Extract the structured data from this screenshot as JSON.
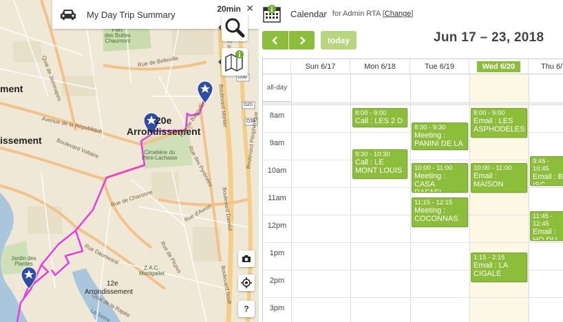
{
  "trip": {
    "title": "My Day Trip Summary",
    "duration": "20min",
    "close": "✕"
  },
  "map": {
    "labels": {
      "arr20_num": "20e",
      "arr20": "Arrondissement",
      "arr_left": "ment",
      "arr_left2": "issement",
      "arr12_num": "12e",
      "arr12": "Arrondissement",
      "park_buttes": "Parc\ndes Buttes\nChaumont",
      "cimetiere": "Cimetière du\nPère-Lachaise",
      "jardin": "Jardin des\nPlantes",
      "zac": "Z.A.C.\nMontgallet",
      "rue_belleville": "Rue de Belleville",
      "av_republique": "Avenue de la République",
      "bd_voltaire": "Boulevard Voltaire",
      "rue_charonne": "Rue de Charonne",
      "rue_pyrenees": "Rue des Pyrénées",
      "rue_avron": "Rue d'Avron",
      "bd_davout": "Boulevard Davout",
      "bd_mortier": "Boulevard Mortier",
      "bd_serurier": "Boulevard Sérurier",
      "rue_picpus": "Rue de Picpus",
      "bd_soult": "Boulevard Soult",
      "rue_daumesnil": "Rue Daumesnil",
      "quai": "Quai de la Rapée",
      "quai_jemmapes": "Quai de Jemmapes",
      "rue_bagnolet": "Rue de Bagnolet",
      "bd_periph": "Boulevard Périphérique",
      "d20": "D20",
      "d36": "D36",
      "d38": "D38",
      "seine": "La Seine"
    },
    "tools": {
      "help": "?"
    },
    "route_color": "#e63ce0",
    "marker_color": "#2f4da6"
  },
  "calendar": {
    "title": "Calendar",
    "for_text": "for Admin RTA [",
    "change": "Change",
    "close_bracket": "]",
    "prev": "‹",
    "next": "›",
    "today": "today",
    "range": "Jun 17 – 23, 2018",
    "allday": "all-day",
    "days": [
      "Sun 6/17",
      "Mon 6/18",
      "Tue 6/19",
      "Wed 6/20",
      "Thu 6/"
    ],
    "today_index": 3,
    "times": [
      "8am",
      "9am",
      "10am",
      "11am",
      "12pm",
      "1pm",
      "2pm",
      "3pm"
    ],
    "accent": "#8cbd3b",
    "events": [
      {
        "time": "8:00 - 9:00",
        "name": "Call : LES 2 D",
        "day": 1
      },
      {
        "time": "9:30 - 10:30",
        "name": "Call : LE MONT LOUIS",
        "day": 1
      },
      {
        "time": "8:30 - 9:30",
        "name": "Meeting : PANINI DE LA",
        "day": 2
      },
      {
        "time": "10:00 - 11:00",
        "name": "Meeting : CASA RAFAEL",
        "day": 2
      },
      {
        "time": "11:15 - 12:15",
        "name": "Meeting : COCONNAS",
        "day": 2
      },
      {
        "time": "8:00 - 9:00",
        "name": "Email : LES ASPHODELES",
        "day": 3
      },
      {
        "time": "10:00 - 11:00",
        "name": "Email : MAISON",
        "day": 3
      },
      {
        "time": "1:15 - 2:15",
        "name": "Email : LA CIGALE",
        "day": 3
      },
      {
        "time": "9:45 - 10:45",
        "name": "Email : BI ISC",
        "day": 4
      },
      {
        "time": "11:45 - 12:45",
        "name": "Email : HO DU PERIG",
        "day": 4
      }
    ]
  }
}
